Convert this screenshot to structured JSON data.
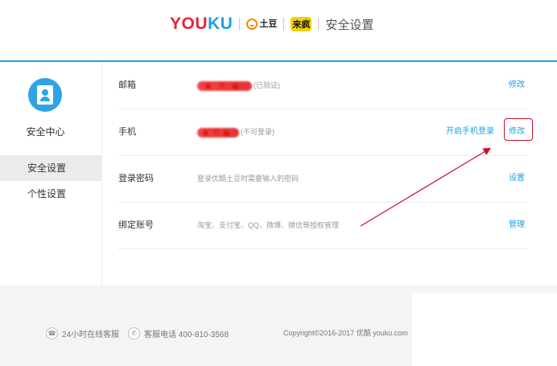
{
  "header": {
    "logo_youku": "YOUKU",
    "logo_tudou": "土豆",
    "logo_laifeng": "来疯",
    "page_title": "安全设置"
  },
  "sidebar": {
    "title": "安全中心",
    "items": [
      {
        "label": "安全设置",
        "active": true
      },
      {
        "label": "个性设置",
        "active": false
      }
    ]
  },
  "rows": [
    {
      "label": "邮箱",
      "value": "(已验证)",
      "action": "修改"
    },
    {
      "label": "手机",
      "value": "(不可登录)",
      "secondary_action": "开启手机登录",
      "action": "修改"
    },
    {
      "label": "登录密码",
      "value": "登录优酷土豆时需要输入的密码",
      "action": "设置"
    },
    {
      "label": "绑定账号",
      "value": "淘宝、支付宝、QQ、微博、微信等授权管理",
      "action": "管理"
    }
  ],
  "footer": {
    "online_service": "24小时在线客服",
    "phone_service": "客服电话 400-810-3568",
    "copyright": "Copyright©2016-2017 优酷 youku.com"
  },
  "colors": {
    "accent": "#1d9fe9",
    "brand_red": "#e5253a",
    "annotation_red": "#c8102e"
  }
}
